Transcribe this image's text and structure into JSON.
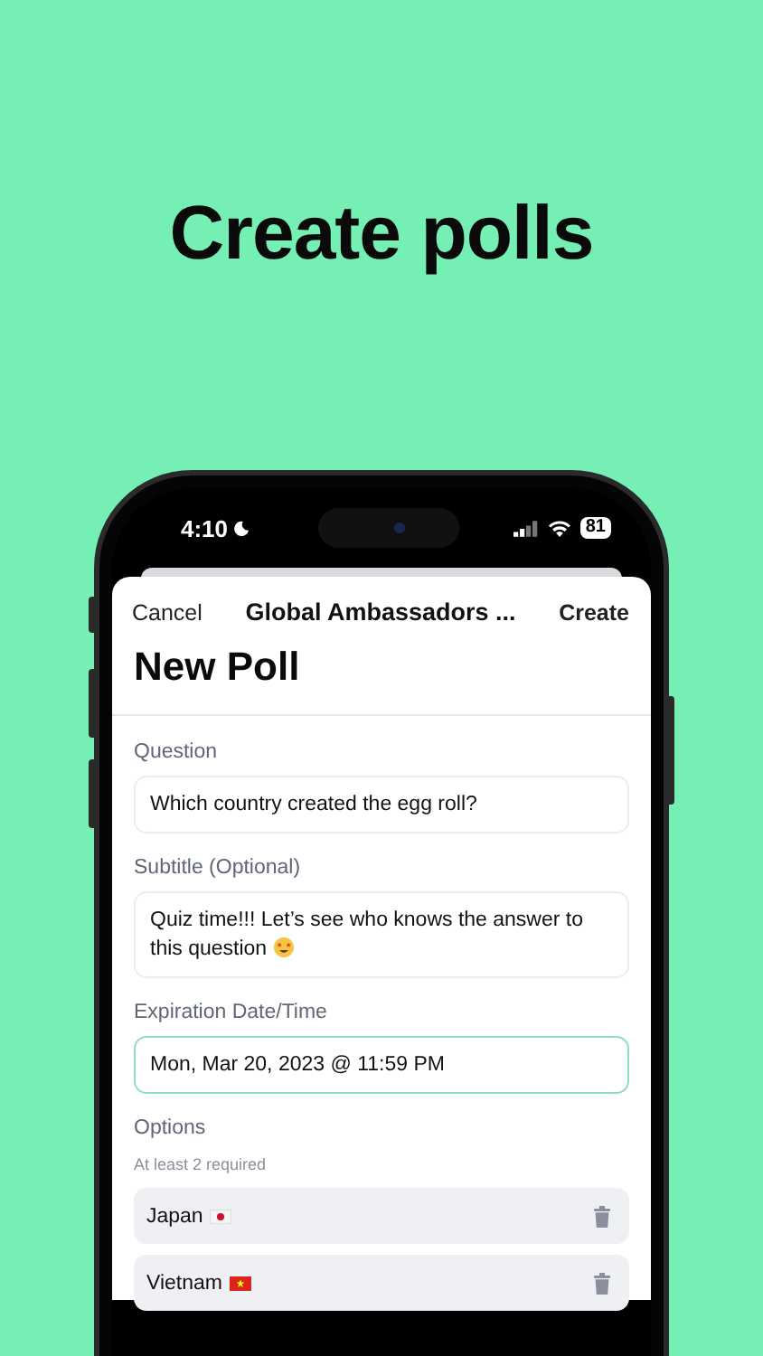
{
  "headline": "Create polls",
  "status_bar": {
    "time": "4:10",
    "battery": "81"
  },
  "nav": {
    "cancel": "Cancel",
    "title": "Global Ambassadors ...",
    "create": "Create"
  },
  "page_title": "New Poll",
  "fields": [
    {
      "label": "Question",
      "value": "Which country created the egg roll?",
      "focused": false
    },
    {
      "label": "Subtitle (Optional)",
      "value": "Quiz time!!! Let’s see who knows the answer to this question",
      "focused": false,
      "has_emoji": true
    },
    {
      "label": "Expiration Date/Time",
      "value": "Mon, Mar 20, 2023 @ 11:59 PM",
      "focused": true
    }
  ],
  "options": {
    "label": "Options",
    "hint": "At least 2 required",
    "items": [
      {
        "text": "Japan",
        "kind": "japan"
      },
      {
        "text": "Vietnam",
        "kind": "vietnam"
      }
    ]
  }
}
